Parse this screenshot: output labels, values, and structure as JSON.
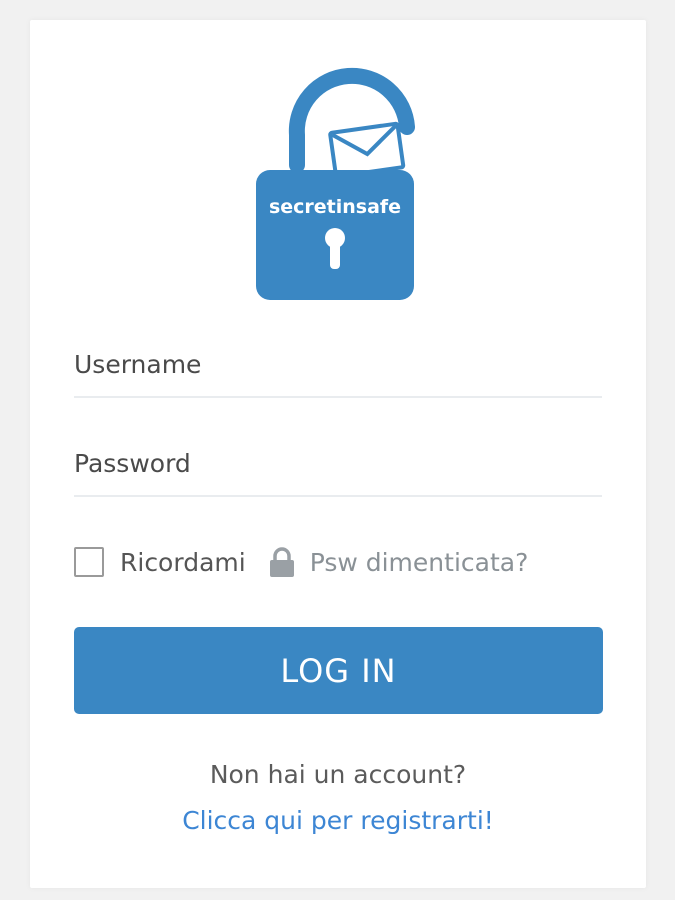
{
  "brand": {
    "logo_text": "secretinsafe",
    "color": "#3a87c3"
  },
  "form": {
    "username_placeholder": "Username",
    "password_placeholder": "Password",
    "remember_label": "Ricordami",
    "forgot_label": "Psw dimenticata?",
    "forgot_icon": "lock-icon",
    "login_label": "LOG IN"
  },
  "footer": {
    "no_account_text": "Non hai un account?",
    "register_link": "Clicca qui per registrarti!",
    "link_color": "#3d86d4"
  }
}
